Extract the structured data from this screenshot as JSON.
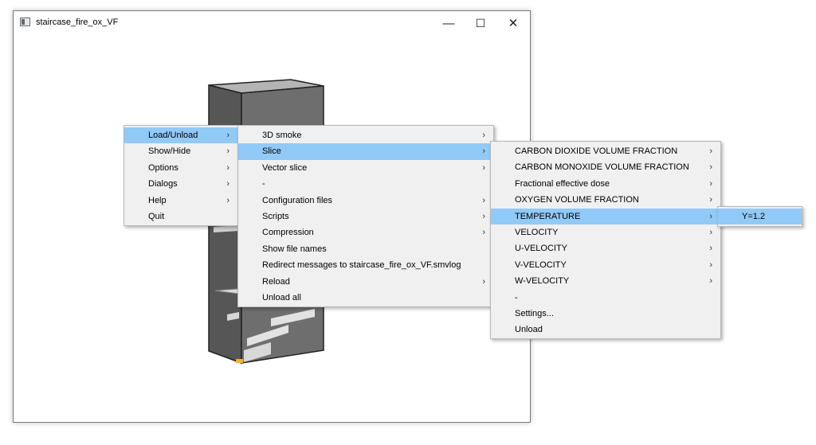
{
  "window": {
    "title": "staircase_fire_ox_VF",
    "minimize_glyph": "—",
    "maximize_glyph": "☐",
    "close_glyph": "✕"
  },
  "menus": {
    "main": [
      {
        "label": "Load/Unload",
        "submenu": true,
        "highlighted": true
      },
      {
        "label": "Show/Hide",
        "submenu": true
      },
      {
        "label": "Options",
        "submenu": true
      },
      {
        "label": "Dialogs",
        "submenu": true
      },
      {
        "label": "Help",
        "submenu": true
      },
      {
        "label": "Quit",
        "submenu": false
      }
    ],
    "load_unload": [
      {
        "label": "3D smoke",
        "submenu": true
      },
      {
        "label": "Slice",
        "submenu": true,
        "highlighted": true
      },
      {
        "label": "Vector slice",
        "submenu": true
      },
      {
        "label": "-",
        "submenu": false
      },
      {
        "label": "Configuration files",
        "submenu": true
      },
      {
        "label": "Scripts",
        "submenu": true
      },
      {
        "label": "Compression",
        "submenu": true
      },
      {
        "label": "Show file names",
        "submenu": false
      },
      {
        "label": "Redirect messages to staircase_fire_ox_VF.smvlog",
        "submenu": false
      },
      {
        "label": "Reload",
        "submenu": true
      },
      {
        "label": "Unload all",
        "submenu": false
      }
    ],
    "slice": [
      {
        "label": "CARBON DIOXIDE VOLUME FRACTION",
        "submenu": true
      },
      {
        "label": "CARBON MONOXIDE VOLUME FRACTION",
        "submenu": true
      },
      {
        "label": "Fractional effective dose",
        "submenu": true
      },
      {
        "label": "OXYGEN VOLUME FRACTION",
        "submenu": true
      },
      {
        "label": "TEMPERATURE",
        "submenu": true,
        "highlighted": true
      },
      {
        "label": "VELOCITY",
        "submenu": true
      },
      {
        "label": "U-VELOCITY",
        "submenu": true
      },
      {
        "label": "V-VELOCITY",
        "submenu": true
      },
      {
        "label": "W-VELOCITY",
        "submenu": true
      },
      {
        "label": "-",
        "submenu": false
      },
      {
        "label": "Settings...",
        "submenu": false
      },
      {
        "label": "Unload",
        "submenu": false
      }
    ],
    "temperature": [
      {
        "label": "Y=1.2",
        "submenu": false,
        "highlighted": true
      }
    ]
  },
  "arrow_glyph": "›",
  "colors": {
    "menu_bg": "#f0f0f0",
    "highlight": "#91c9f7",
    "fire": "#f0b33a"
  }
}
